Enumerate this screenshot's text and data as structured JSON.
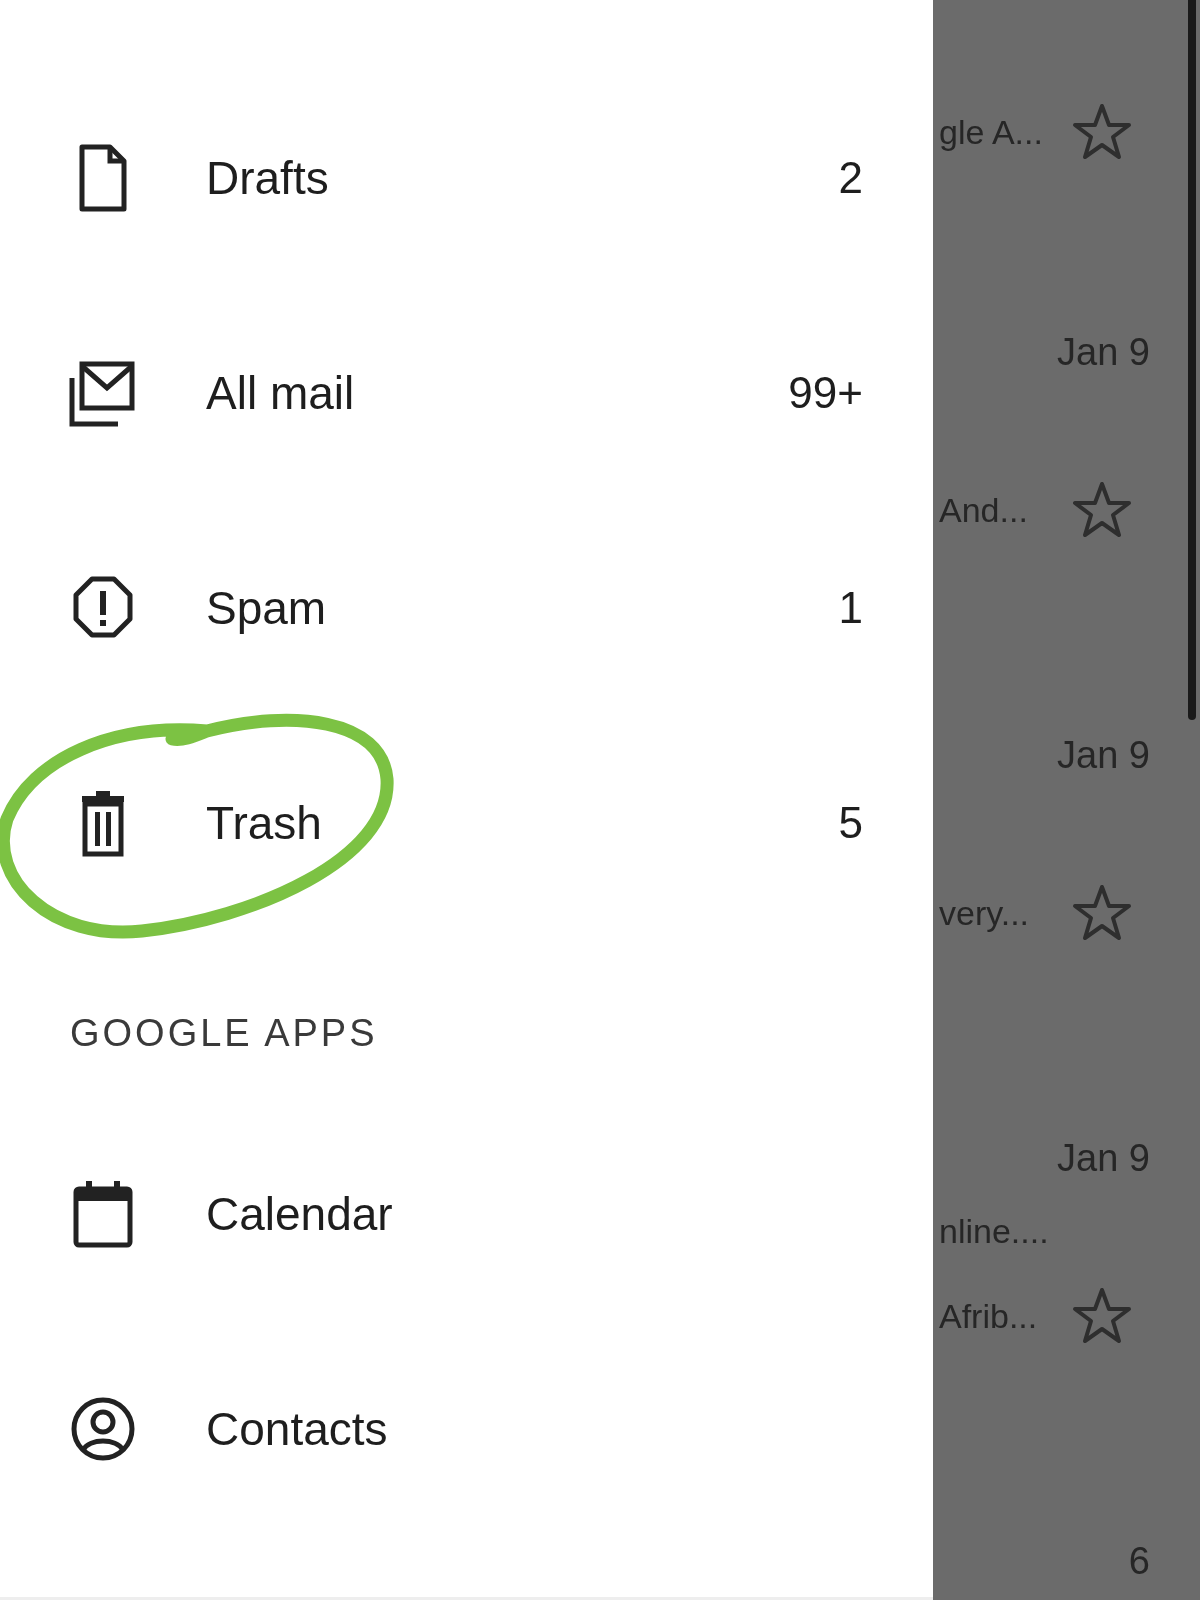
{
  "drawer": {
    "items": [
      {
        "kind": "draft",
        "label": "Drafts",
        "count": "2",
        "circled": false
      },
      {
        "kind": "allmail",
        "label": "All mail",
        "count": "99+",
        "circled": false
      },
      {
        "kind": "spam",
        "label": "Spam",
        "count": "1",
        "circled": false
      },
      {
        "kind": "trash",
        "label": "Trash",
        "count": "5",
        "circled": true
      }
    ],
    "section_header": "GOOGLE APPS",
    "apps": [
      {
        "kind": "calendar",
        "label": "Calendar"
      },
      {
        "kind": "contacts",
        "label": "Contacts"
      }
    ]
  },
  "mail_list": {
    "emails": [
      {
        "lines": [
          "gle A..."
        ],
        "starred": false
      },
      {
        "date": "Jan 9",
        "lines": [
          "And..."
        ],
        "starred": false
      },
      {
        "date": "Jan 9",
        "lines": [
          "very..."
        ],
        "starred": false
      },
      {
        "date": "Jan 9",
        "lines": [
          "nline....",
          "Afrib..."
        ],
        "starred": false
      },
      {
        "date": "6"
      }
    ]
  }
}
